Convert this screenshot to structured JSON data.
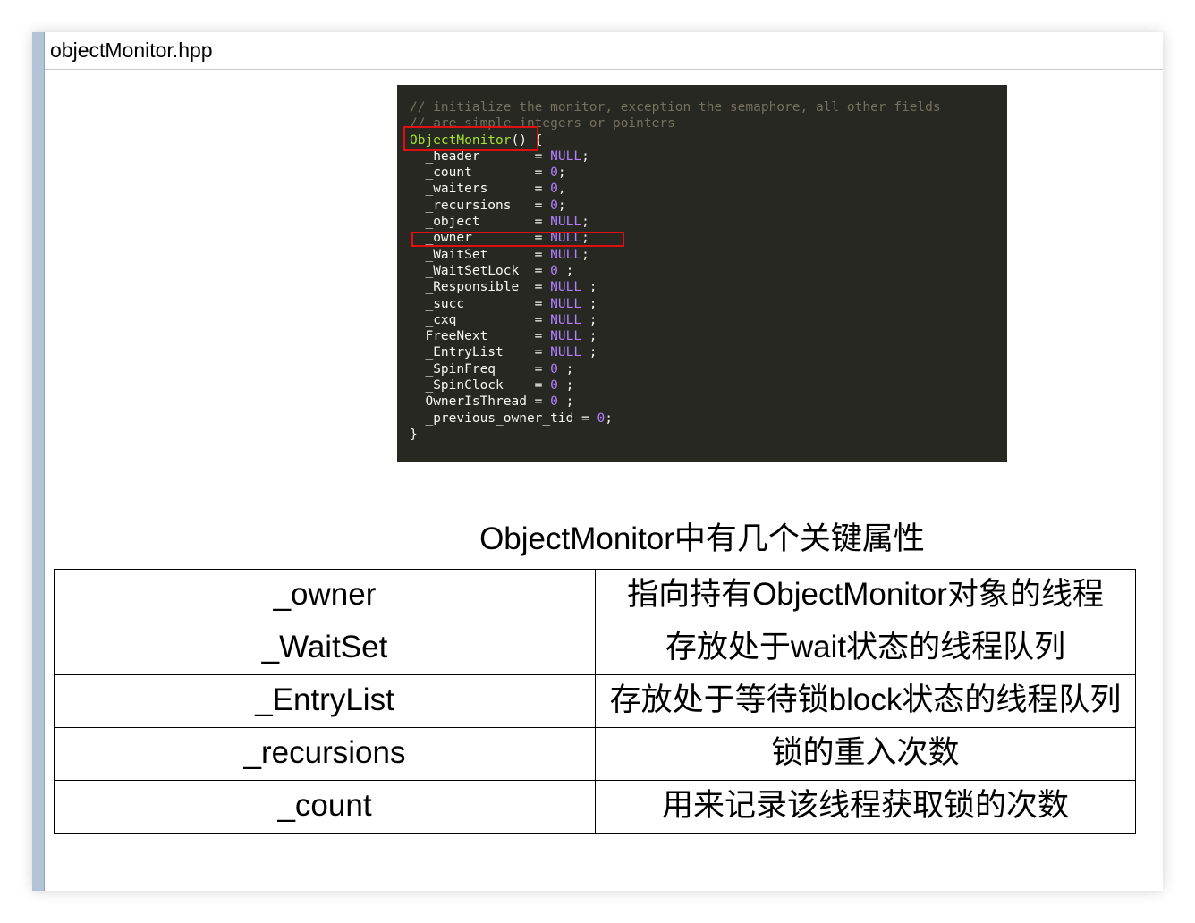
{
  "window": {
    "title": "objectMonitor.hpp"
  },
  "code": {
    "lines": [
      [
        {
          "t": "// initialize the monitor, exception the semaphore, all other fields",
          "c": "comment"
        }
      ],
      [
        {
          "t": "// are simple integers or pointers",
          "c": "comment"
        }
      ],
      [
        {
          "t": "ObjectMonitor",
          "c": "fn"
        },
        {
          "t": "() {",
          "c": "text"
        }
      ],
      [
        {
          "t": "  _header       = ",
          "c": "text"
        },
        {
          "t": "NULL",
          "c": "const"
        },
        {
          "t": ";",
          "c": "text"
        }
      ],
      [
        {
          "t": "  _count        = ",
          "c": "text"
        },
        {
          "t": "0",
          "c": "const"
        },
        {
          "t": ";",
          "c": "text"
        }
      ],
      [
        {
          "t": "  _waiters      = ",
          "c": "text"
        },
        {
          "t": "0",
          "c": "const"
        },
        {
          "t": ",",
          "c": "text"
        }
      ],
      [
        {
          "t": "  _recursions   = ",
          "c": "text"
        },
        {
          "t": "0",
          "c": "const"
        },
        {
          "t": ";",
          "c": "text"
        }
      ],
      [
        {
          "t": "  _object       = ",
          "c": "text"
        },
        {
          "t": "NULL",
          "c": "const"
        },
        {
          "t": ";",
          "c": "text"
        }
      ],
      [
        {
          "t": "  _owner        = ",
          "c": "text"
        },
        {
          "t": "NULL",
          "c": "const"
        },
        {
          "t": ";",
          "c": "text"
        }
      ],
      [
        {
          "t": "  _WaitSet      = ",
          "c": "text"
        },
        {
          "t": "NULL",
          "c": "const"
        },
        {
          "t": ";",
          "c": "text"
        }
      ],
      [
        {
          "t": "  _WaitSetLock  = ",
          "c": "text"
        },
        {
          "t": "0",
          "c": "const"
        },
        {
          "t": " ;",
          "c": "text"
        }
      ],
      [
        {
          "t": "  _Responsible  = ",
          "c": "text"
        },
        {
          "t": "NULL",
          "c": "const"
        },
        {
          "t": " ;",
          "c": "text"
        }
      ],
      [
        {
          "t": "  _succ         = ",
          "c": "text"
        },
        {
          "t": "NULL",
          "c": "const"
        },
        {
          "t": " ;",
          "c": "text"
        }
      ],
      [
        {
          "t": "  _cxq          = ",
          "c": "text"
        },
        {
          "t": "NULL",
          "c": "const"
        },
        {
          "t": " ;",
          "c": "text"
        }
      ],
      [
        {
          "t": "  FreeNext      = ",
          "c": "text"
        },
        {
          "t": "NULL",
          "c": "const"
        },
        {
          "t": " ;",
          "c": "text"
        }
      ],
      [
        {
          "t": "  _EntryList    = ",
          "c": "text"
        },
        {
          "t": "NULL",
          "c": "const"
        },
        {
          "t": " ;",
          "c": "text"
        }
      ],
      [
        {
          "t": "  _SpinFreq     = ",
          "c": "text"
        },
        {
          "t": "0",
          "c": "const"
        },
        {
          "t": " ;",
          "c": "text"
        }
      ],
      [
        {
          "t": "  _SpinClock    = ",
          "c": "text"
        },
        {
          "t": "0",
          "c": "const"
        },
        {
          "t": " ;",
          "c": "text"
        }
      ],
      [
        {
          "t": "  OwnerIsThread = ",
          "c": "text"
        },
        {
          "t": "0",
          "c": "const"
        },
        {
          "t": " ;",
          "c": "text"
        }
      ],
      [
        {
          "t": "  _previous_owner_tid = ",
          "c": "text"
        },
        {
          "t": "0",
          "c": "const"
        },
        {
          "t": ";",
          "c": "text"
        }
      ],
      [
        {
          "t": "}",
          "c": "text"
        }
      ]
    ],
    "colors": {
      "background": "#272822",
      "comment": "#75715e",
      "function": "#a6e22e",
      "constant": "#ae81ff",
      "text": "#f8f8f2",
      "highlight_box": "#e01010"
    }
  },
  "caption": "ObjectMonitor中有几个关键属性",
  "table": {
    "rows": [
      {
        "key": "_owner",
        "desc": "指向持有ObjectMonitor对象的线程"
      },
      {
        "key": "_WaitSet",
        "desc": "存放处于wait状态的线程队列"
      },
      {
        "key": "_EntryList",
        "desc": "存放处于等待锁block状态的线程队列"
      },
      {
        "key": "_recursions",
        "desc": "锁的重入次数"
      },
      {
        "key": "_count",
        "desc": "用来记录该线程获取锁的次数"
      }
    ]
  }
}
